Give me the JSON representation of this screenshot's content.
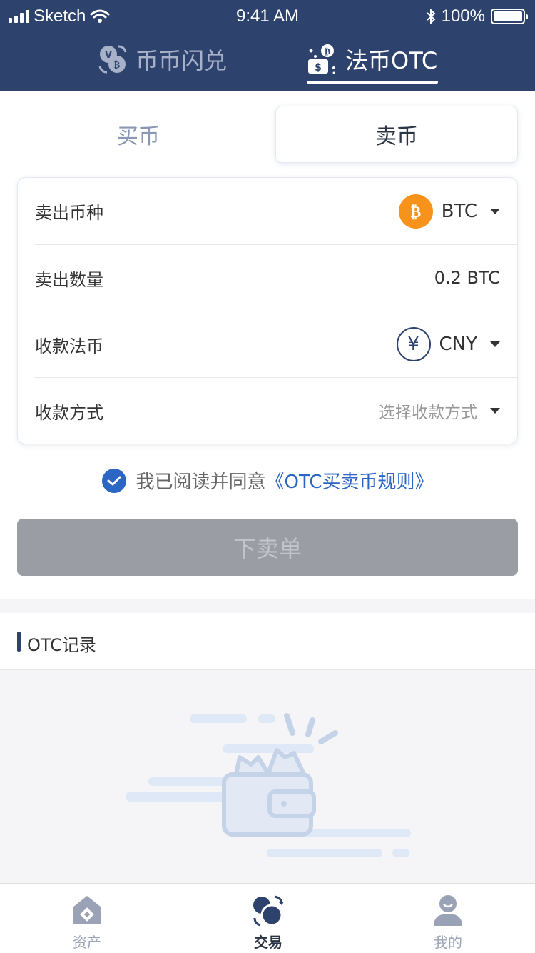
{
  "status_bar": {
    "carrier": "Sketch",
    "time": "9:41 AM",
    "battery": "100%"
  },
  "top_tabs": [
    {
      "label": "币币闪兑",
      "active": false
    },
    {
      "label": "法币OTC",
      "active": true
    }
  ],
  "trade_toggle": {
    "buy_label": "买币",
    "sell_label": "卖币",
    "active": "sell"
  },
  "form": {
    "coin": {
      "label": "卖出币种",
      "value": "BTC",
      "icon": "bitcoin-icon"
    },
    "amount": {
      "label": "卖出数量",
      "value": "0.2 BTC"
    },
    "fiat": {
      "label": "收款法币",
      "value": "CNY",
      "icon": "yen-icon",
      "icon_glyph": "¥"
    },
    "payment": {
      "label": "收款方式",
      "placeholder": "选择收款方式"
    }
  },
  "agreement": {
    "checked": true,
    "text": "我已阅读并同意",
    "link": "《OTC买卖币规则》"
  },
  "submit_label": "下卖单",
  "records": {
    "title": "OTC记录"
  },
  "bottom_tabs": [
    {
      "label": "资产",
      "icon": "assets-icon",
      "active": false
    },
    {
      "label": "交易",
      "icon": "trade-icon",
      "active": true
    },
    {
      "label": "我的",
      "icon": "profile-icon",
      "active": false
    }
  ],
  "colors": {
    "header_bg": "#2e426e",
    "accent_blue": "#2c66c4",
    "bitcoin_orange": "#f7931a",
    "disabled_button": "#9a9da4"
  }
}
